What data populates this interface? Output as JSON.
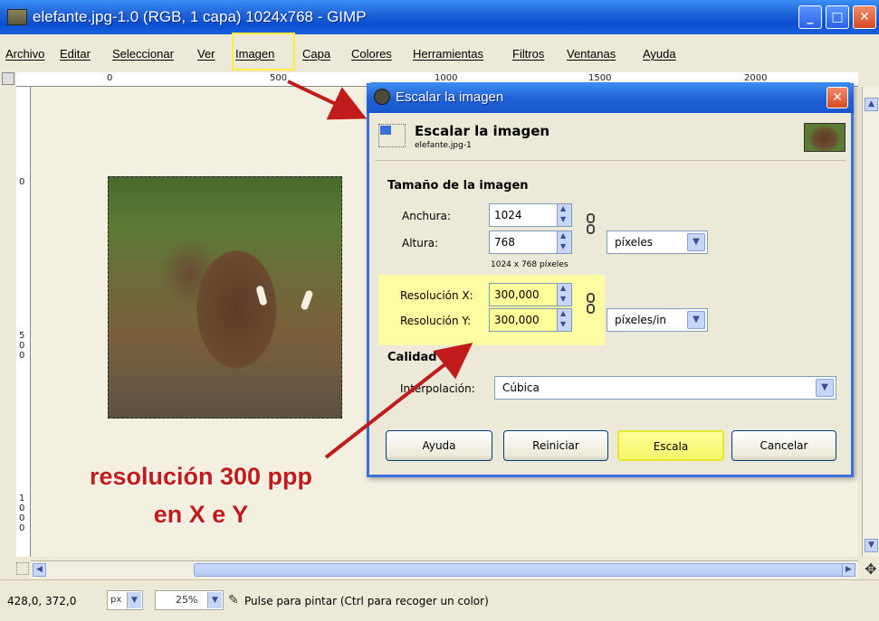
{
  "window": {
    "title": "elefante.jpg-1.0 (RGB, 1 capa) 1024x768 - GIMP",
    "min": "_",
    "max": "□",
    "close": "✕"
  },
  "menu": [
    "Archivo",
    "Editar",
    "Seleccionar",
    "Ver",
    "Imagen",
    "Capa",
    "Colores",
    "Herramientas",
    "Filtros",
    "Ventanas",
    "Ayuda"
  ],
  "ruler": {
    "h": [
      "0",
      "500",
      "1000",
      "1500",
      "2000"
    ],
    "v": [
      "0",
      "5\n0\n0",
      "1\n0\n0\n0"
    ]
  },
  "dialog": {
    "title": "Escalar la imagen",
    "header": "Escalar la imagen",
    "subheader": "elefante.jpg-1",
    "size_section": "Tamaño de la imagen",
    "width_label": "Anchura:",
    "width_value": "1024",
    "height_label": "Altura:",
    "height_value": "768",
    "size_unit": "píxeles",
    "size_note": "1024 x 768 píxeles",
    "resx_label": "Resolución X:",
    "resx_value": "300,000",
    "resy_label": "Resolución Y:",
    "resy_value": "300,000",
    "res_unit": "píxeles/in",
    "quality_section": "Calidad",
    "interp_label": "Interpolación:",
    "interp_value": "Cúbica",
    "buttons": {
      "help": "Ayuda",
      "reset": "Reiniciar",
      "scale": "Escala",
      "cancel": "Cancelar"
    }
  },
  "status": {
    "coords": "428,0, 372,0",
    "unit": "px",
    "zoom": "25%",
    "message": "Pulse para pintar (Ctrl para recoger un color)"
  },
  "annotation": {
    "line1": "resolución 300 ppp",
    "line2": "en X e Y"
  },
  "colors": {
    "highlight": "#ffef3a",
    "arrow": "#c21b1b",
    "titlebar": "#1f63d8"
  }
}
